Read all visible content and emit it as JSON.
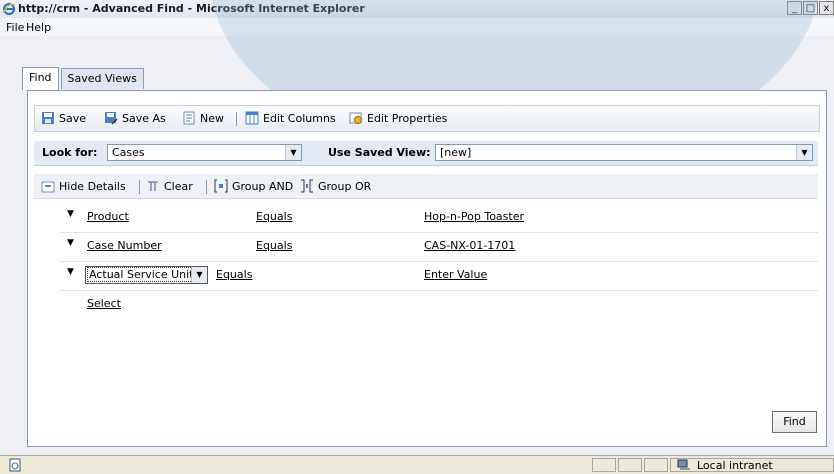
{
  "window": {
    "title": "http://crm - Advanced Find - Microsoft Internet Explorer",
    "minimize": "_",
    "maximize": "□",
    "close": "x"
  },
  "menu": [
    {
      "label": "File"
    },
    {
      "label": "Help"
    }
  ],
  "tabs": [
    {
      "label": "Find",
      "active": true
    },
    {
      "label": "Saved Views",
      "active": false
    }
  ],
  "toolbar": {
    "save": "Save",
    "save_as": "Save As",
    "new": "New",
    "edit_columns": "Edit Columns",
    "edit_properties": "Edit Properties"
  },
  "look_for": {
    "label": "Look for:",
    "value": "Cases"
  },
  "saved_view": {
    "label": "Use Saved View:",
    "value": "[new]"
  },
  "details_bar": {
    "hide_details": "Hide Details",
    "clear": "Clear",
    "group_and": "Group AND",
    "group_or": "Group OR"
  },
  "criteria": [
    {
      "field": "Product",
      "operator": "Equals",
      "value": "Hop-n-Pop Toaster"
    },
    {
      "field": "Case Number",
      "operator": "Equals",
      "value": "CAS-NX-01-1701"
    },
    {
      "field": "Actual Service Units",
      "operator": "Equals",
      "value": "Enter Value"
    }
  ],
  "select_link": "Select",
  "find_button": "Find",
  "status": {
    "zone": "Local intranet"
  },
  "icons": [
    "ie-logo-icon",
    "save-icon",
    "save-as-icon",
    "new-icon",
    "edit-columns-icon",
    "edit-properties-icon",
    "hide-details-icon",
    "clear-icon",
    "group-and-icon",
    "group-or-icon",
    "caret-down-icon",
    "dropdown-arrow-icon",
    "page-icon",
    "intranet-icon"
  ],
  "colors": {
    "frame_bg": "#eef0f6",
    "toolbar_border": "#c6cfdd",
    "lookbar_bg": "#e3e9f2",
    "title_text": "#1a1a1a",
    "status_bg": "#ece9d8"
  }
}
